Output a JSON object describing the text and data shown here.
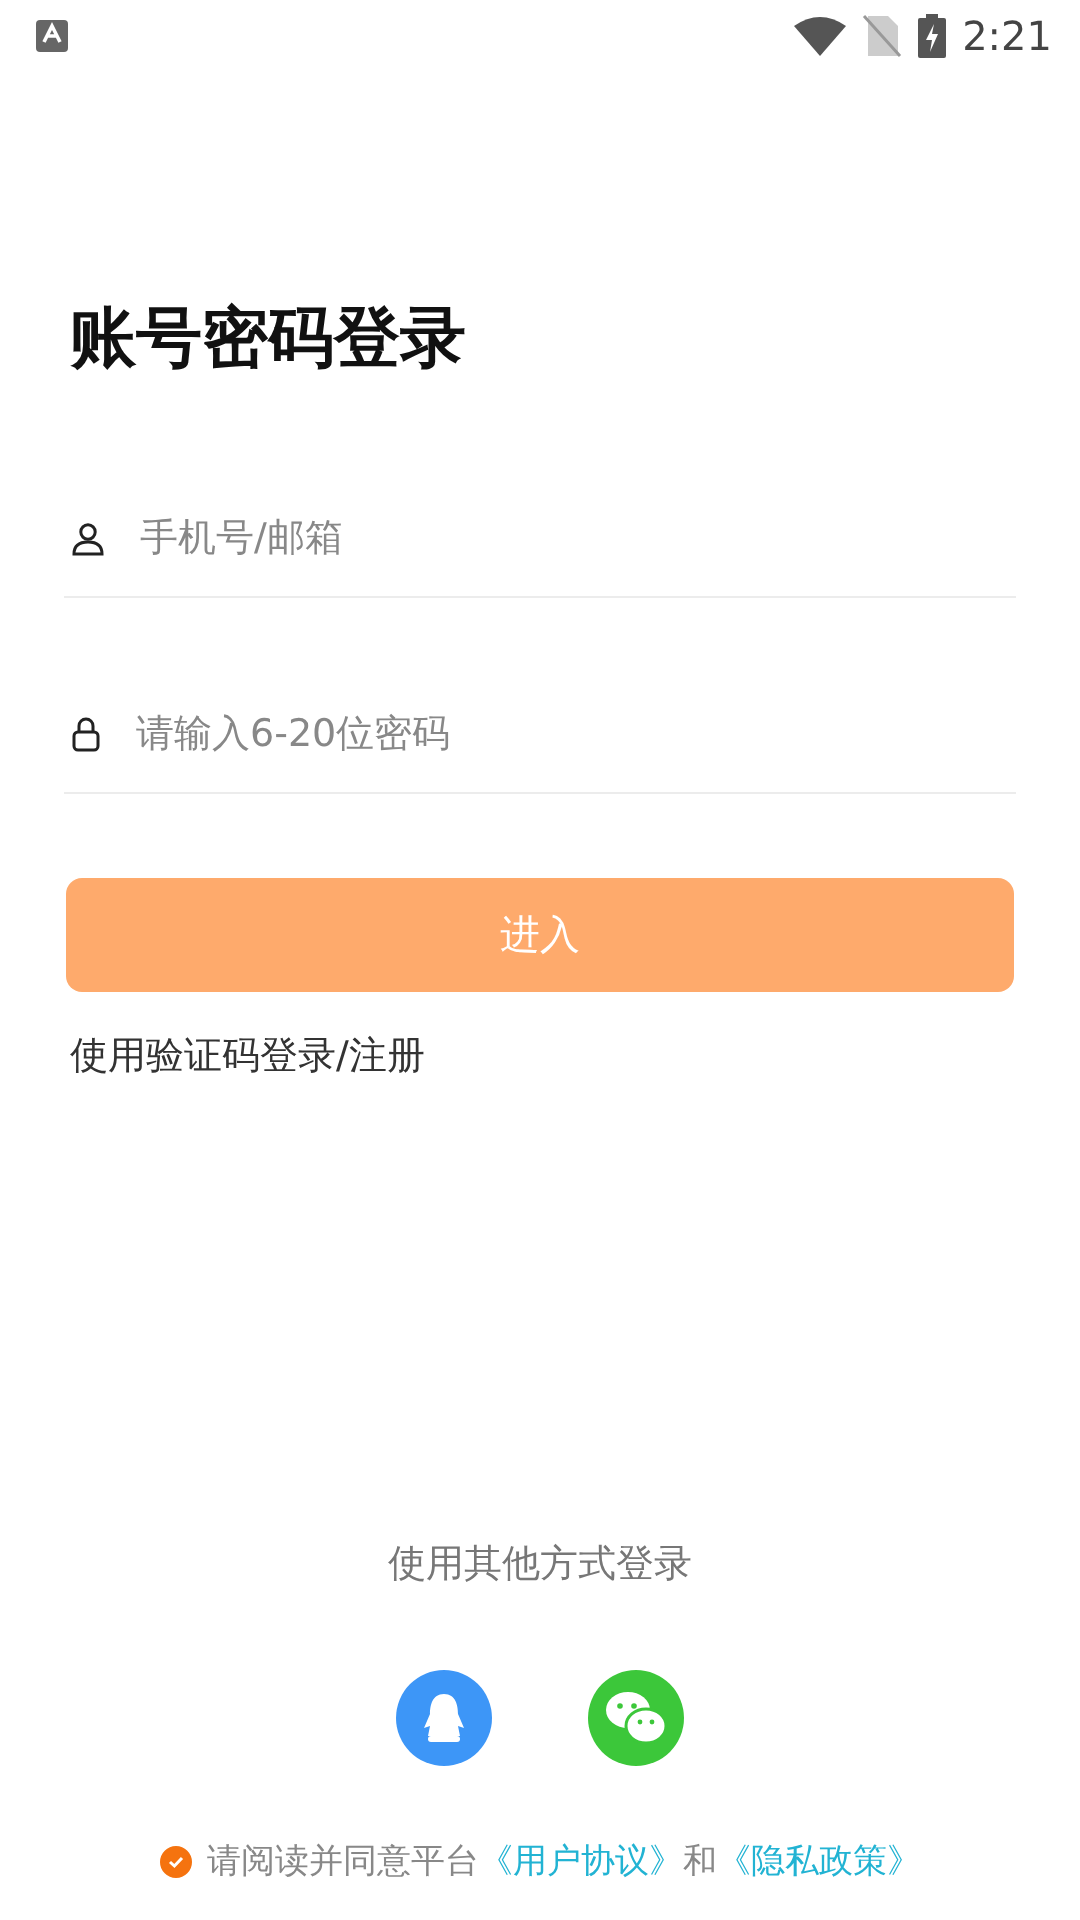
{
  "status_bar": {
    "time": "2:21"
  },
  "title": "账号密码登录",
  "fields": [
    {
      "kind": "user",
      "placeholder": "手机号/邮箱"
    },
    {
      "kind": "lock",
      "placeholder": "请输入6-20位密码"
    }
  ],
  "submit_button": "进入",
  "code_login_link": "使用验证码登录/注册",
  "other_login": {
    "label": "使用其他方式登录",
    "providers": [
      {
        "kind": "qq",
        "color": "#3d96f7"
      },
      {
        "kind": "wechat",
        "color": "#3cc73a"
      }
    ]
  },
  "agreement": {
    "checked": true,
    "text": "请阅读并同意平台",
    "links": [
      "《用户协议》",
      "《隐私政策》"
    ],
    "joiner": "和"
  }
}
